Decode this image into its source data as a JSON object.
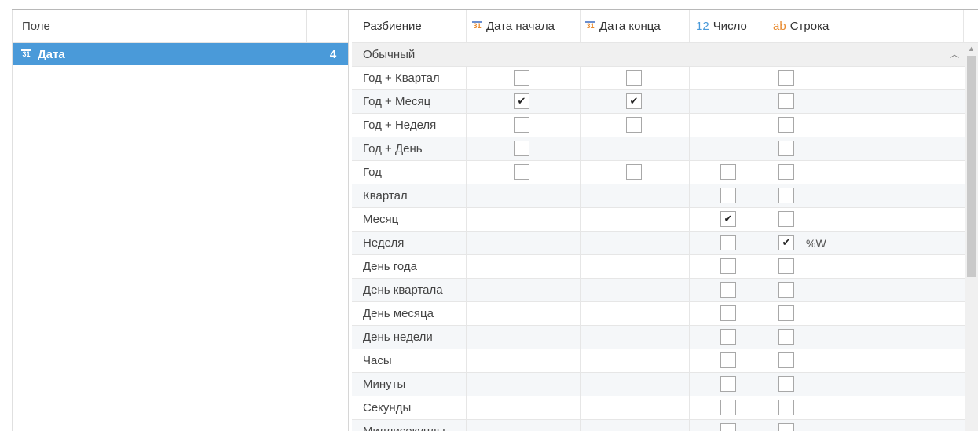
{
  "left_panel": {
    "header": "Поле",
    "fields": [
      {
        "icon": "calendar-icon",
        "icon_text": "31",
        "name": "Дата",
        "count": "4"
      }
    ]
  },
  "grid": {
    "headers": {
      "breakdown": "Разбиение",
      "start_date_icon": "31",
      "start_date": "Дата начала",
      "end_date_icon": "31",
      "end_date": "Дата конца",
      "number_icon": "12",
      "number": "Число",
      "string_icon": "ab",
      "string": "Строка"
    },
    "group_label": "Обычный",
    "rows": [
      {
        "label": "Год + Квартал",
        "start": false,
        "end": false,
        "num": null,
        "str": false
      },
      {
        "label": "Год + Месяц",
        "start": true,
        "end": true,
        "num": null,
        "str": false
      },
      {
        "label": "Год + Неделя",
        "start": false,
        "end": false,
        "num": null,
        "str": false
      },
      {
        "label": "Год + День",
        "start": false,
        "end": null,
        "num": null,
        "str": false
      },
      {
        "label": "Год",
        "start": false,
        "end": false,
        "num": false,
        "str": false
      },
      {
        "label": "Квартал",
        "start": null,
        "end": null,
        "num": false,
        "str": false
      },
      {
        "label": "Месяц",
        "start": null,
        "end": null,
        "num": true,
        "str": false
      },
      {
        "label": "Неделя",
        "start": null,
        "end": null,
        "num": false,
        "str": true,
        "format": "%W"
      },
      {
        "label": "День года",
        "start": null,
        "end": null,
        "num": false,
        "str": false
      },
      {
        "label": "День квартала",
        "start": null,
        "end": null,
        "num": false,
        "str": false
      },
      {
        "label": "День месяца",
        "start": null,
        "end": null,
        "num": false,
        "str": false
      },
      {
        "label": "День недели",
        "start": null,
        "end": null,
        "num": false,
        "str": false
      },
      {
        "label": "Часы",
        "start": null,
        "end": null,
        "num": false,
        "str": false
      },
      {
        "label": "Минуты",
        "start": null,
        "end": null,
        "num": false,
        "str": false
      },
      {
        "label": "Секунды",
        "start": null,
        "end": null,
        "num": false,
        "str": false
      },
      {
        "label": "Миллисекунды",
        "start": null,
        "end": null,
        "num": false,
        "str": false
      }
    ]
  },
  "colors": {
    "selection": "#4a9ad9",
    "date_icon": "#e8892c",
    "number_icon": "#4a9ad9",
    "string_icon": "#e8892c"
  },
  "check_glyph": "✔"
}
